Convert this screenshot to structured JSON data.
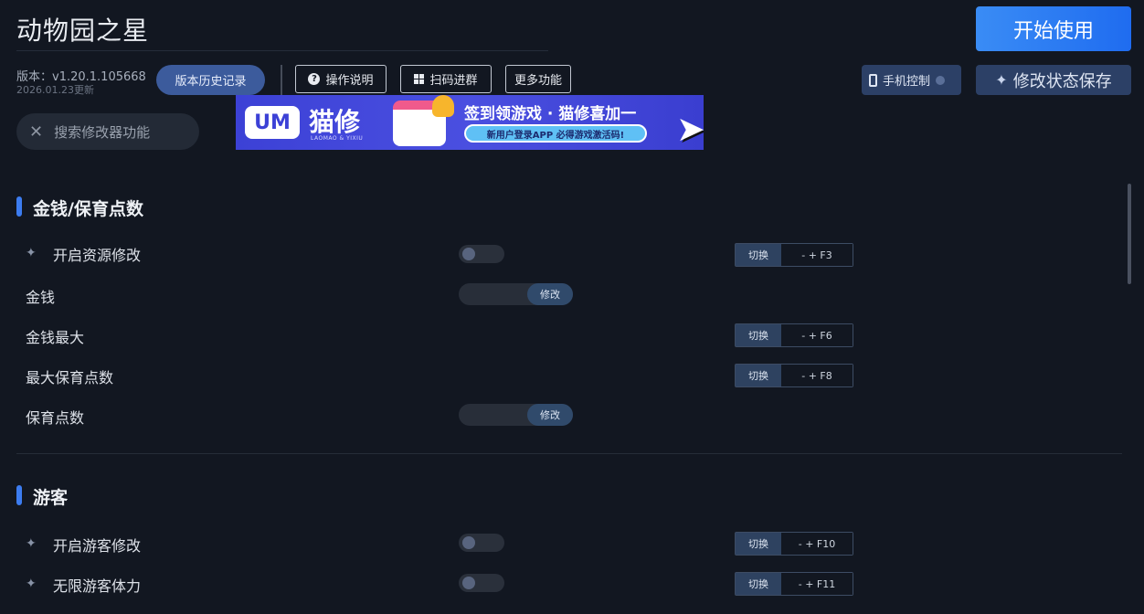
{
  "app": {
    "title": "动物园之星",
    "start_label": "开始使用"
  },
  "meta": {
    "version": "版本：v1.20.1.105668",
    "date": "2026.01.23更新"
  },
  "toolbar": {
    "history": "版本历史记录",
    "guide": "操作说明",
    "scan": "扫码进群",
    "more": "更多功能",
    "phone": "手机控制",
    "save": "修改状态保存"
  },
  "search": {
    "placeholder": "搜索修改器功能"
  },
  "banner": {
    "logo_text": "UM",
    "brand": "猫修",
    "brand_sub": "LAOMAO & YIXIU",
    "headline": "签到领游戏 · 猫修喜加一",
    "pill": "新用户登录APP  必得游戏激活码!"
  },
  "sections": [
    {
      "title": "金钱/保育点数",
      "rows": [
        {
          "label": "开启资源修改",
          "control": "toggle",
          "on": false,
          "hotkey_switch": "切换",
          "hotkey": "- + F3"
        },
        {
          "label": "金钱",
          "control": "modify",
          "modify_label": "修改"
        },
        {
          "label": "金钱最大",
          "control": "none",
          "hotkey_switch": "切换",
          "hotkey": "- + F6"
        },
        {
          "label": "最大保育点数",
          "control": "none",
          "hotkey_switch": "切换",
          "hotkey": "- + F8"
        },
        {
          "label": "保育点数",
          "control": "modify",
          "modify_label": "修改"
        }
      ]
    },
    {
      "title": "游客",
      "rows": [
        {
          "label": "开启游客修改",
          "control": "toggle",
          "on": false,
          "hotkey_switch": "切换",
          "hotkey": "- + F10"
        },
        {
          "label": "无限游客体力",
          "control": "toggle",
          "on": false,
          "hotkey_switch": "切换",
          "hotkey": "- + F11"
        }
      ]
    }
  ]
}
